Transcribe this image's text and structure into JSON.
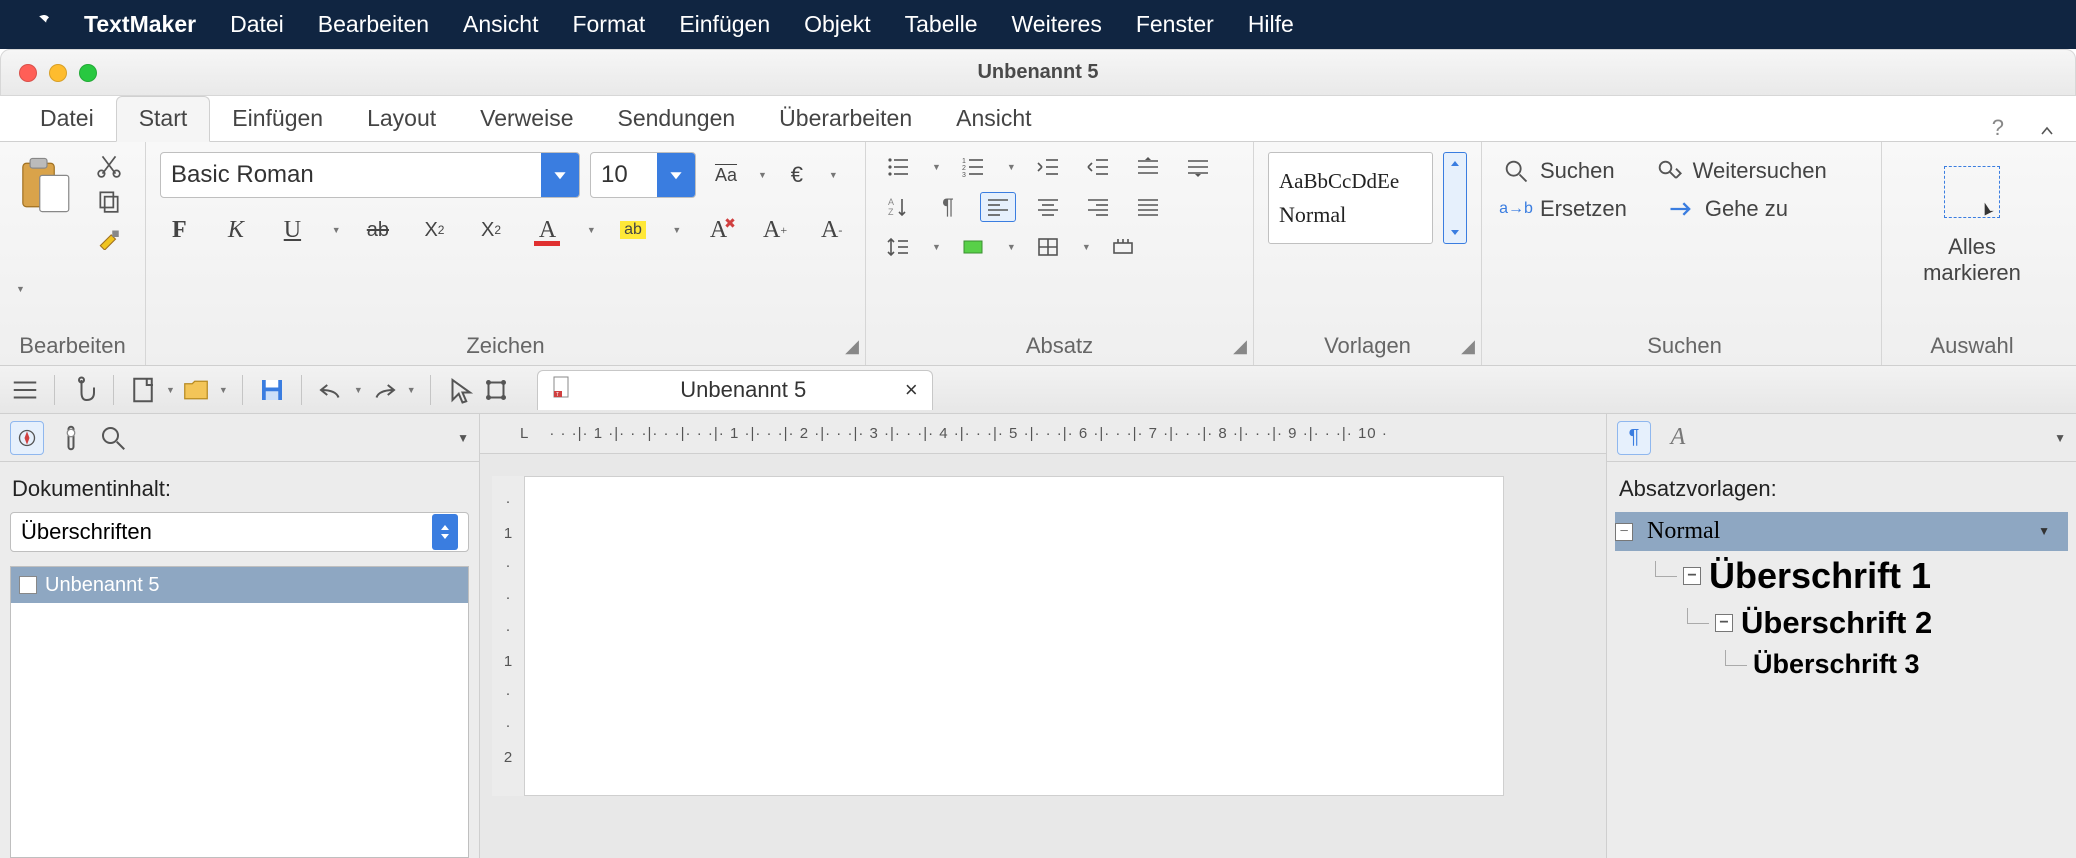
{
  "menubar": {
    "app": "TextMaker",
    "items": [
      "Datei",
      "Bearbeiten",
      "Ansicht",
      "Format",
      "Einfügen",
      "Objekt",
      "Tabelle",
      "Weiteres",
      "Fenster",
      "Hilfe"
    ]
  },
  "window": {
    "title": "Unbenannt 5"
  },
  "ribbon_tabs": [
    "Datei",
    "Start",
    "Einfügen",
    "Layout",
    "Verweise",
    "Sendungen",
    "Überarbeiten",
    "Ansicht"
  ],
  "ribbon_active_tab": "Start",
  "help_label": "?",
  "groups": {
    "bearbeiten": "Bearbeiten",
    "zeichen": "Zeichen",
    "absatz": "Absatz",
    "vorlagen": "Vorlagen",
    "suchen": "Suchen",
    "auswahl": "Auswahl"
  },
  "font": {
    "name": "Basic Roman",
    "size": "10"
  },
  "style_preview": {
    "sample": "AaBbCcDdEe",
    "name": "Normal"
  },
  "search": {
    "suchen": "Suchen",
    "weitersuchen": "Weitersuchen",
    "ersetzen": "Ersetzen",
    "gehezu": "Gehe zu"
  },
  "auswahl": {
    "line1": "Alles",
    "line2": "markieren"
  },
  "doctab": {
    "title": "Unbenannt 5"
  },
  "left_panel": {
    "heading": "Dokumentinhalt:",
    "selector": "Überschriften",
    "tree_item": "Unbenannt 5"
  },
  "ruler": {
    "tab_corner": "L",
    "horiz": "· · ·|· 1 ·|· · ·|· · ·|· · ·|· 1 ·|· · ·|· 2 ·|· · ·|· 3 ·|· · ·|· 4 ·|· · ·|· 5 ·|· · ·|· 6 ·|· · ·|· 7 ·|· · ·|· 8 ·|· · ·|· 9 ·|· · ·|· 10 ·",
    "vert": [
      "·",
      "1",
      "·",
      "·",
      "·",
      "1",
      "·",
      "·",
      "2"
    ]
  },
  "right_panel": {
    "heading": "Absatzvorlagen:",
    "items": [
      "Normal",
      "Überschrift 1",
      "Überschrift 2",
      "Überschrift 3"
    ]
  }
}
